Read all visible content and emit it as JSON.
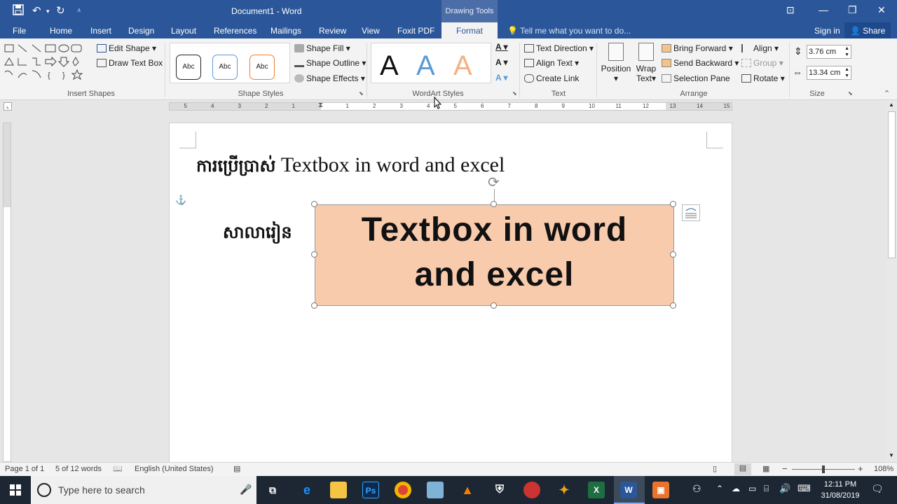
{
  "titlebar": {
    "title": "Document1 - Word",
    "context_tab": "Drawing Tools",
    "minimize": "—",
    "restore": "❐",
    "close": "✕"
  },
  "tabs": {
    "file": "File",
    "home": "Home",
    "insert": "Insert",
    "design": "Design",
    "layout": "Layout",
    "references": "References",
    "mailings": "Mailings",
    "review": "Review",
    "view": "View",
    "foxit": "Foxit PDF",
    "format": "Format",
    "tellme": "Tell me what you want to do...",
    "signin": "Sign in",
    "share": "Share"
  },
  "ribbon": {
    "insert_shapes": {
      "label": "Insert Shapes",
      "edit_shape": "Edit Shape",
      "draw_text_box": "Draw Text Box"
    },
    "shape_styles": {
      "label": "Shape Styles",
      "abc": "Abc",
      "fill": "Shape Fill",
      "outline": "Shape Outline",
      "effects": "Shape Effects"
    },
    "wordart": {
      "label": "WordArt Styles",
      "letter": "A"
    },
    "text": {
      "label": "Text",
      "direction": "Text Direction",
      "align": "Align Text",
      "link": "Create Link"
    },
    "arrange": {
      "label": "Arrange",
      "position": "Position",
      "wrap1": "Wrap",
      "wrap2": "Text",
      "bring": "Bring Forward",
      "send": "Send Backward",
      "pane": "Selection Pane",
      "align": "Align",
      "group": "Group",
      "rotate": "Rotate"
    },
    "size": {
      "label": "Size",
      "height": "3.76 cm",
      "width": "13.34 cm"
    }
  },
  "ruler": {
    "numbers": [
      "5",
      "4",
      "3",
      "2",
      "1",
      "1",
      "2",
      "3",
      "4",
      "5",
      "6",
      "7",
      "8",
      "9",
      "10",
      "11",
      "12",
      "13",
      "14",
      "15"
    ]
  },
  "document": {
    "heading_khmer": "ការប្រើប្រាស់",
    "heading_text": "Textbox in word and excel",
    "khmer_label": "សាលារៀន",
    "textbox_line1": "Textbox in word",
    "textbox_line2": "and excel"
  },
  "status": {
    "page": "Page 1 of 1",
    "words": "5 of 12 words",
    "language": "English (United States)",
    "zoom": "108%"
  },
  "taskbar": {
    "search": "Type here to search",
    "time": "12:11 PM",
    "date": "31/08/2019"
  },
  "colors": {
    "accent": "#2b579a",
    "textbox_fill": "#f8cbad"
  }
}
